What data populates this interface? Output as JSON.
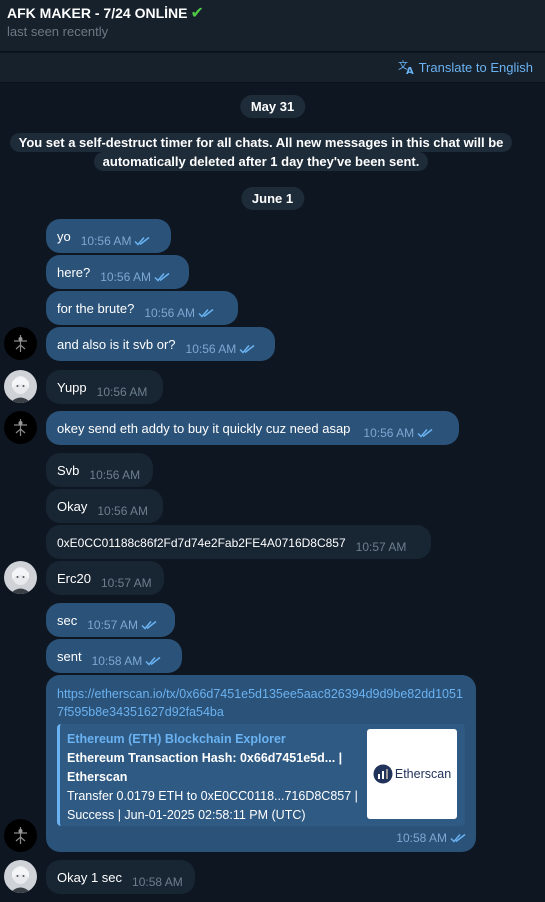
{
  "header": {
    "title": "AFK MAKER - 7/24 ONLİNE",
    "title_emoji": "✔",
    "status": "last seen recently"
  },
  "translate_bar": {
    "label": "Translate to English"
  },
  "chat": {
    "date_1": "May 31",
    "service_message": "You set a self-destruct timer for all chats. All new messages in this chat will be automatically deleted after 1 day they've been sent.",
    "date_2": "June 1",
    "messages": [
      {
        "text": "yo",
        "time": "10:56 AM",
        "outgoing": true
      },
      {
        "text": "here?",
        "time": "10:56 AM",
        "outgoing": true
      },
      {
        "text": "for the brute?",
        "time": "10:56 AM",
        "outgoing": true
      },
      {
        "text": "and also is it svb or?",
        "time": "10:56 AM",
        "outgoing": true
      },
      {
        "text": "Yupp",
        "time": "10:56 AM",
        "outgoing": false
      },
      {
        "text": "okey send eth addy to buy it quickly cuz need asap",
        "time": "10:56 AM",
        "outgoing": true
      },
      {
        "text": "Svb",
        "time": "10:56 AM",
        "outgoing": false
      },
      {
        "text": "Okay",
        "time": "10:56 AM",
        "outgoing": false
      },
      {
        "text": "0xE0CC01188c86f2Fd7d74e2Fab2FE4A0716D8C857",
        "time": "10:57 AM",
        "outgoing": false
      },
      {
        "text": "Erc20",
        "time": "10:57 AM",
        "outgoing": false
      },
      {
        "text": "sec",
        "time": "10:57 AM",
        "outgoing": true
      },
      {
        "text": "sent",
        "time": "10:58 AM",
        "outgoing": true
      },
      {
        "text": "https://etherscan.io/tx/0x66d7451e5d135ee5aac826394d9d9be82dd10517f595b8e34351627d92fa54ba",
        "time": "10:58 AM",
        "outgoing": true
      },
      {
        "text": "Okay 1 sec",
        "time": "10:58 AM",
        "outgoing": false
      }
    ],
    "link_preview": {
      "site": "Ethereum (ETH) Blockchain Explorer",
      "title": "Ethereum Transaction Hash: 0x66d7451e5d... | Etherscan",
      "description": "Transfer 0.0179 ETH to 0xE0CC0118...716D8C857 | Success | Jun-01-2025 02:58:11 PM (UTC)",
      "thumb_text": "Etherscan"
    }
  },
  "colors": {
    "background": "#0e1621",
    "header": "#17212b",
    "incoming_bubble": "#182533",
    "outgoing_bubble": "#2b5278",
    "link": "#6ab2f2",
    "online_check": "#4fc945"
  },
  "icons": [
    "check-icon",
    "translate-icon",
    "double-check-icon",
    "avatar-dark",
    "avatar-light"
  ]
}
